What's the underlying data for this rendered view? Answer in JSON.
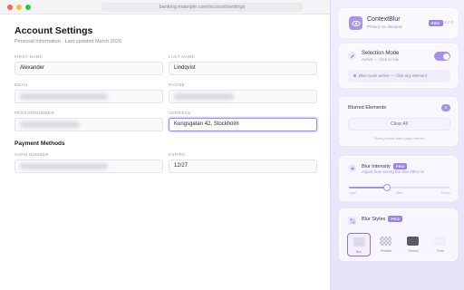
{
  "browser": {
    "url": "banking.example.com/account/settings"
  },
  "page": {
    "title": "Account Settings",
    "subtitle": "Personal Information · Last updated March 2026",
    "fields": {
      "first_name": {
        "label": "FIRST NAME",
        "value": "Alexander"
      },
      "last_name": {
        "label": "LAST NAME",
        "value": "Lindqvist"
      },
      "email": {
        "label": "EMAIL"
      },
      "phone": {
        "label": "PHONE"
      },
      "personnummer": {
        "label": "PERSONNUMMER"
      },
      "address": {
        "label": "ADDRESS",
        "value": "Kungsgatan 42, Stockholm"
      },
      "card_number": {
        "label": "CARD NUMBER"
      },
      "expiry": {
        "label": "EXPIRY",
        "value": "12/27"
      }
    },
    "payment_title": "Payment Methods"
  },
  "extension": {
    "name": "ContextBlur",
    "tagline": "Privacy on demand",
    "badge": "PRO",
    "version": "v2.0.0",
    "selection": {
      "title": "Selection Mode",
      "subtitle": "Active — click to blur",
      "status": "Blur mode active — click any element",
      "enabled": true
    },
    "blurred": {
      "title": "Blurred Elements",
      "count": "4",
      "clear_label": "Clear All",
      "note": "Blurs persist after page refresh"
    },
    "intensity": {
      "title": "Blur Intensity",
      "badge": "PRO",
      "subtitle": "Adjust how strong the blur effect is",
      "level": 0.38,
      "scale": {
        "min": "Light",
        "mid": "Med",
        "max": "Heavy"
      }
    },
    "styles": {
      "title": "Blur Styles",
      "badge": "PRO",
      "options": [
        "Blur",
        "Pixelate",
        "Redact",
        "Fade"
      ],
      "selected": "Blur"
    }
  }
}
